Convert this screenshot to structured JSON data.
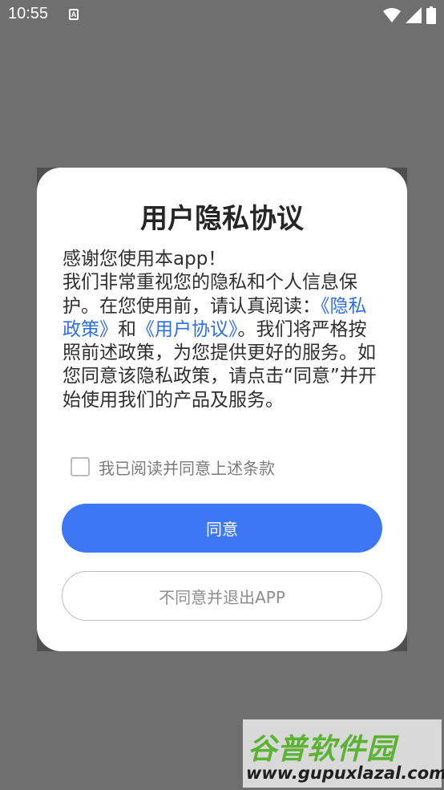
{
  "status_bar": {
    "time": "10:55",
    "notification_icon_letter": "A",
    "icons": [
      "wifi-icon",
      "signal-icon",
      "battery-icon"
    ]
  },
  "dialog": {
    "title": "用户隐私协议",
    "body": {
      "line1": "感谢您使用本app！",
      "part1": "我们非常重视您的隐私和个人信息保护。在您使用前，请认真阅读：",
      "privacy_link": "《隐私政策》",
      "and": "和",
      "user_link": "《用户协议》",
      "part2": "。我们将严格按照前述政策，为您提供更好的服务。如您同意该隐私政策，请点击“同意”并开始使用我们的产品及服务。"
    },
    "consent_label": "我已阅读并同意上述条款",
    "agree_button": "同意",
    "decline_button": "不同意并退出APP"
  },
  "watermark": {
    "logo_text": "谷普软件园",
    "url": "www.gupuxlazal.com"
  },
  "colors": {
    "overlay": "#6f6f6f",
    "primary": "#3d77f5",
    "link": "#2e6ee6"
  }
}
